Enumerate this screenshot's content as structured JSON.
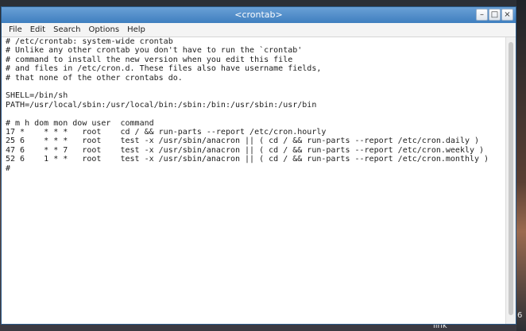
{
  "window": {
    "title": "<crontab>",
    "min_glyph": "–",
    "max_glyph": "□",
    "close_glyph": "×"
  },
  "menu": {
    "file": "File",
    "edit": "Edit",
    "search": "Search",
    "options": "Options",
    "help": "Help"
  },
  "editor": {
    "content": "# /etc/crontab: system-wide crontab\n# Unlike any other crontab you don't have to run the `crontab'\n# command to install the new version when you edit this file\n# and files in /etc/cron.d. These files also have username fields,\n# that none of the other crontabs do.\n\nSHELL=/bin/sh\nPATH=/usr/local/sbin:/usr/local/bin:/sbin:/bin:/usr/sbin:/usr/bin\n\n# m h dom mon dow user  command\n17 *    * * *   root    cd / && run-parts --report /etc/cron.hourly\n25 6    * * *   root    test -x /usr/sbin/anacron || ( cd / && run-parts --report /etc/cron.daily )\n47 6    * * 7   root    test -x /usr/sbin/anacron || ( cd / && run-parts --report /etc/cron.weekly )\n52 6    1 * *   root    test -x /usr/sbin/anacron || ( cd / && run-parts --report /etc/cron.monthly )\n#"
  },
  "desktop": {
    "link_label": "link",
    "edge_label": "6"
  },
  "colors": {
    "titlebar": "#3f7fbf",
    "editor_bg": "#ffffff"
  }
}
